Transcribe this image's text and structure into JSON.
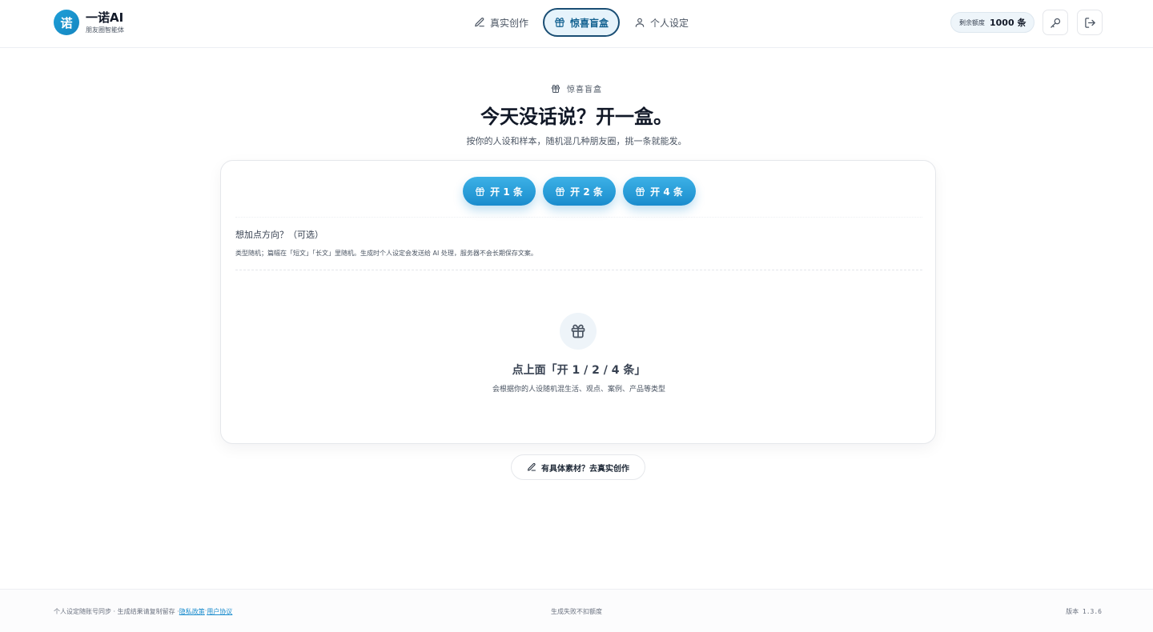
{
  "brand": {
    "logo_char": "诺",
    "name": "一诺AI",
    "tagline": "朋友圈智能体",
    "accent": "#1e9fd8"
  },
  "nav": {
    "items": [
      {
        "label": "真实创作",
        "icon": "pencil-icon",
        "active": false
      },
      {
        "label": "惊喜盲盒",
        "icon": "gift-icon",
        "active": true
      },
      {
        "label": "个人设定",
        "icon": "user-icon",
        "active": false
      }
    ]
  },
  "quota": {
    "label": "剩余额度",
    "value": "1000 条"
  },
  "header_icons": [
    "key-icon",
    "logout-icon"
  ],
  "hero": {
    "tag": "惊喜盲盒",
    "title": "今天没话说？开一盒。",
    "subtitle": "按你的人设和样本，随机混几种朋友圈，挑一条就能发。"
  },
  "card": {
    "open_buttons": [
      "开 1 条",
      "开 2 条",
      "开 4 条"
    ],
    "direction_label": "想加点方向？（可选）",
    "direction_note": "类型随机；篇幅在「短文」「长文」里随机。生成时个人设定会发送给 AI 处理，服务器不会长期保存文案。",
    "empty_title": "点上面「开 1 / 2 / 4 条」",
    "empty_subtitle": "会根据你的人设随机混生活、观点、案例、产品等类型"
  },
  "real_link": "有具体素材？去真实创作",
  "footer": {
    "left_text": "个人设定随账号同步 · 生成结果请复制留存 · ",
    "privacy": "隐私政策",
    "separator": " · ",
    "terms": "用户协议",
    "center": "生成失败不扣额度",
    "version": "版本 1.3.6"
  }
}
